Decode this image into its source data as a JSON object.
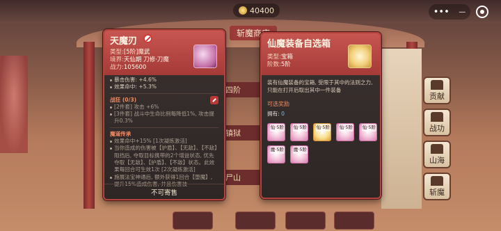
{
  "background": {
    "currency_amount": "40400",
    "shop_title": "斩魔商店",
    "shelf_labels": [
      "四阶",
      "镇狱",
      "尸山"
    ],
    "bottom_buttons": [
      "",
      "",
      "",
      ""
    ],
    "sidebar": [
      {
        "label": "贡献",
        "icon": "contribution-icon"
      },
      {
        "label": "战功",
        "icon": "battle-merit-icon"
      },
      {
        "label": "山海",
        "icon": "mountain-sea-icon"
      },
      {
        "label": "斩魔",
        "icon": "demon-slayer-icon"
      }
    ],
    "top_menu": {
      "more": "•••",
      "minimize": "—"
    }
  },
  "left_panel": {
    "title": "天魔刃",
    "type_label": "类型:",
    "type_value": "[5阶]魔武",
    "realm_label": "境界:",
    "realm_value": "天仙期 刀修·刀魔",
    "power_label": "战力:",
    "power_value": "105600",
    "stats": [
      "暴击伤害: +4.6%",
      "效果命中: +5.3%"
    ],
    "set_title": "战狂 (0/3)",
    "set_lines": [
      "[2件套] 攻击 +6%",
      "[3件套] 战斗中生命比例每降低1%, 攻击提升0.3%"
    ],
    "legend_title": "魔道传承",
    "legend_lines": [
      "效果命中+15% [1次凝炼激活]",
      "当你造成的伤害被【护盾】、【无敌】、【不敌】阻挡后, 夺取目标携带的2个增益状态, 优先夺取【无敌】、【护盾】、【不敌】状态。此效果每回合可生效1次 [2次凝炼激活]",
      "施展法宝神通后, 额外获得1回合【堕魔】, 提升15%造成伤害, 并且伤害技"
    ],
    "footer": "不可寄售"
  },
  "right_panel": {
    "title": "仙魔装备自选箱",
    "type_label": "类型:",
    "type_value": "宝箱",
    "tier_label": "阶数:",
    "tier_value": "5阶",
    "description": "装有仙魔装备的宝箱, 受限于其中的法则之力, 只能在打开后取出其中一件装备",
    "rewards_title": "可选奖励",
    "owned_label": "拥有:",
    "owned_value": "0",
    "rewards": [
      {
        "level": "仙·5阶",
        "icon": "immortal-blade-icon"
      },
      {
        "level": "仙·5阶",
        "icon": "immortal-armor-icon"
      },
      {
        "level": "仙·5阶",
        "icon": "immortal-orb-icon"
      },
      {
        "level": "仙·5阶",
        "icon": "immortal-wing-icon"
      },
      {
        "level": "仙·5阶",
        "icon": "immortal-claw-icon"
      },
      {
        "level": "魔·5阶",
        "icon": "demon-blade-icon"
      },
      {
        "level": "魔·5阶",
        "icon": "demon-armor-icon"
      }
    ]
  }
}
